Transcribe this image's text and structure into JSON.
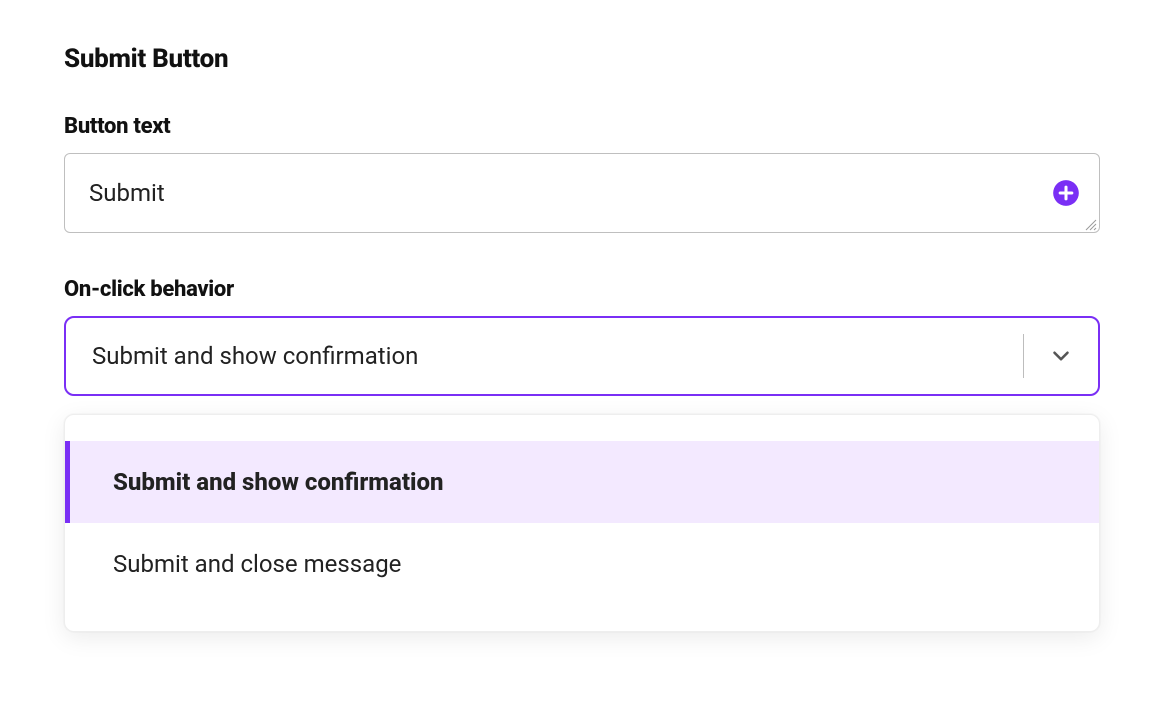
{
  "section": {
    "title": "Submit Button"
  },
  "buttonText": {
    "label": "Button text",
    "value": "Submit"
  },
  "onClick": {
    "label": "On-click behavior",
    "selected": "Submit and show confirmation",
    "options": [
      "Submit and show confirmation",
      "Submit and close message"
    ]
  },
  "colors": {
    "accent": "#7a2ff5",
    "highlight": "#f3e9ff"
  }
}
